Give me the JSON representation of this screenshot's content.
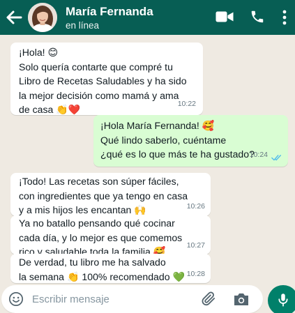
{
  "header": {
    "contact_name": "María Fernanda",
    "status": "en línea",
    "icons": [
      "back-arrow-icon",
      "video-call-icon",
      "phone-icon",
      "more-options-icon"
    ]
  },
  "messages": [
    {
      "direction": "incoming",
      "lines": [
        "¡Hola! 😊",
        "Solo quería contarte que compré tu",
        "Libro de Recetas Saludables y ha sido",
        "la mejor decisión como mamá y ama",
        "de casa 👏❤️"
      ],
      "time": "10:22"
    },
    {
      "direction": "outgoing",
      "lines": [
        "¡Hola María Fernanda! 🥰",
        "Qué lindo saberlo, cuéntame",
        "¿qué es lo que más te ha gustado?"
      ],
      "time": "10:24",
      "status": "read"
    },
    {
      "direction": "incoming",
      "lines": [
        "¡Todo! Las recetas son súper fáciles,",
        "con ingredientes que ya tengo en casa",
        "y a mis hijos les encantan 🙌"
      ],
      "time": "10:26"
    },
    {
      "direction": "incoming",
      "lines": [
        "Ya no batallo pensando qué cocinar",
        "cada día, y lo mejor es que comemos",
        "rico y saludable toda la familia 🥰"
      ],
      "time": "10:27"
    },
    {
      "direction": "incoming",
      "lines": [
        "De verdad, tu libro me ha salvado",
        "la semana 👏 100% recomendado 💚"
      ],
      "time": "10:28"
    }
  ],
  "composer": {
    "placeholder": "Escribir mensaje",
    "icons": [
      "emoji-icon",
      "attach-icon",
      "camera-icon",
      "microphone-icon"
    ]
  },
  "colors": {
    "header": "#075e54",
    "chat_background": "#efeae2",
    "incoming_bubble": "#ffffff",
    "outgoing_bubble": "#d9fdd3",
    "read_ticks": "#53bdeb",
    "mic_button": "#00806a"
  }
}
